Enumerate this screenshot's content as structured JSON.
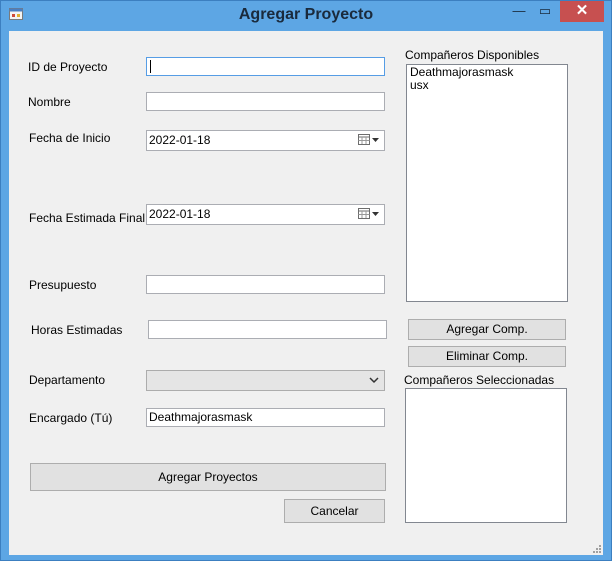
{
  "window": {
    "title": "Agregar Proyecto",
    "minimize_glyph": "—",
    "maximize_glyph": "▭",
    "close_glyph": "✕",
    "icon": "app-form-icon"
  },
  "form": {
    "id_label": "ID de Proyecto",
    "id_value": "",
    "nombre_label": "Nombre",
    "nombre_value": "",
    "fecha_inicio_label": "Fecha de Inicio",
    "fecha_inicio_value": "2022-01-18",
    "fecha_final_label": "Fecha Estimada Final",
    "fecha_final_value": "2022-01-18",
    "presupuesto_label": "Presupuesto",
    "presupuesto_value": "",
    "horas_label": "Horas Estimadas",
    "horas_value": "",
    "departamento_label": "Departamento",
    "departamento_value": "",
    "encargado_label": "Encargado (Tú)",
    "encargado_value": "Deathmajorasmask"
  },
  "companeros": {
    "disponibles_label": "Compañeros Disponibles",
    "disponibles": [
      "Deathmajorasmask",
      "usx"
    ],
    "seleccionados_label": "Compañeros Seleccionadas",
    "seleccionados": [],
    "agregar_label": "Agregar Comp.",
    "eliminar_label": "Eliminar Comp."
  },
  "actions": {
    "agregar_label": "Agregar Proyectos",
    "cancelar_label": "Cancelar"
  },
  "colors": {
    "frame": "#5da6e4",
    "client": "#f0f0f0",
    "close": "#c75050",
    "focus_border": "#569de5"
  }
}
